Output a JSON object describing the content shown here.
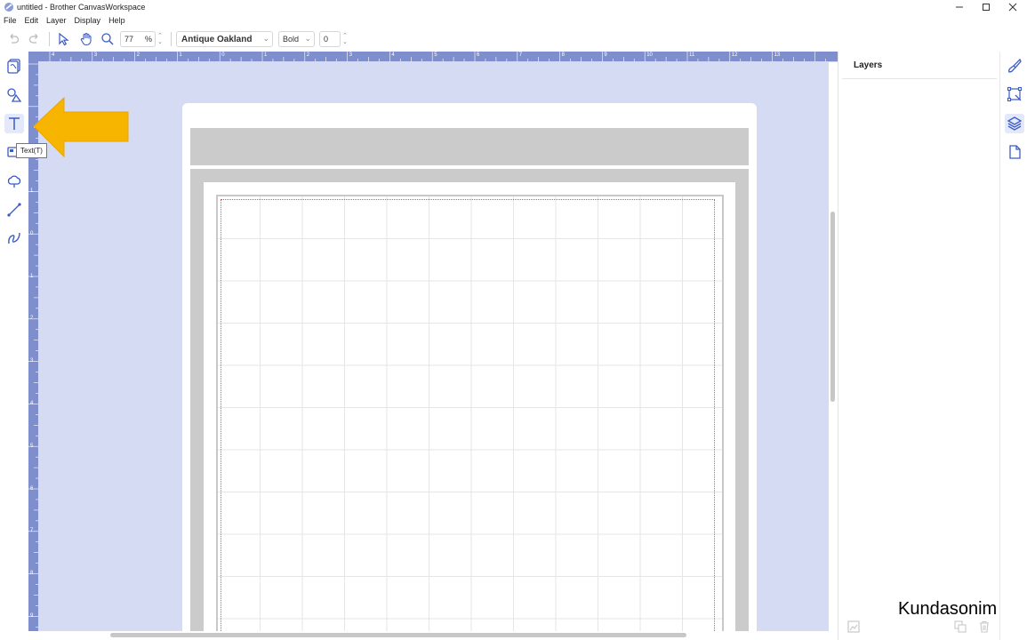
{
  "window": {
    "title": "untitled - Brother CanvasWorkspace"
  },
  "menu": [
    "File",
    "Edit",
    "Layer",
    "Display",
    "Help"
  ],
  "toolbar": {
    "zoom_value": "77",
    "zoom_unit": "%",
    "font_name": "Antique Oakland",
    "font_style": "Bold",
    "spacing_value": "0"
  },
  "tools": {
    "active": "text-tool",
    "tooltip": "Text(T)"
  },
  "ruler": {
    "top_labels": [
      "4",
      "3",
      "2",
      "1",
      "0",
      "1",
      "2",
      "3",
      "4",
      "5",
      "6",
      "7",
      "8",
      "9",
      "10",
      "11",
      "12",
      "13"
    ],
    "left_labels": [
      "1",
      "0",
      "1",
      "2",
      "3",
      "4",
      "5",
      "6",
      "7",
      "8",
      "9"
    ]
  },
  "panel": {
    "title": "Layers"
  },
  "watermark": "Kundasonim",
  "colors": {
    "accent": "#3a5bc7",
    "canvas_bg": "#d4dbf3",
    "ruler": "#7f8fce",
    "arrow": "#f7b500"
  }
}
